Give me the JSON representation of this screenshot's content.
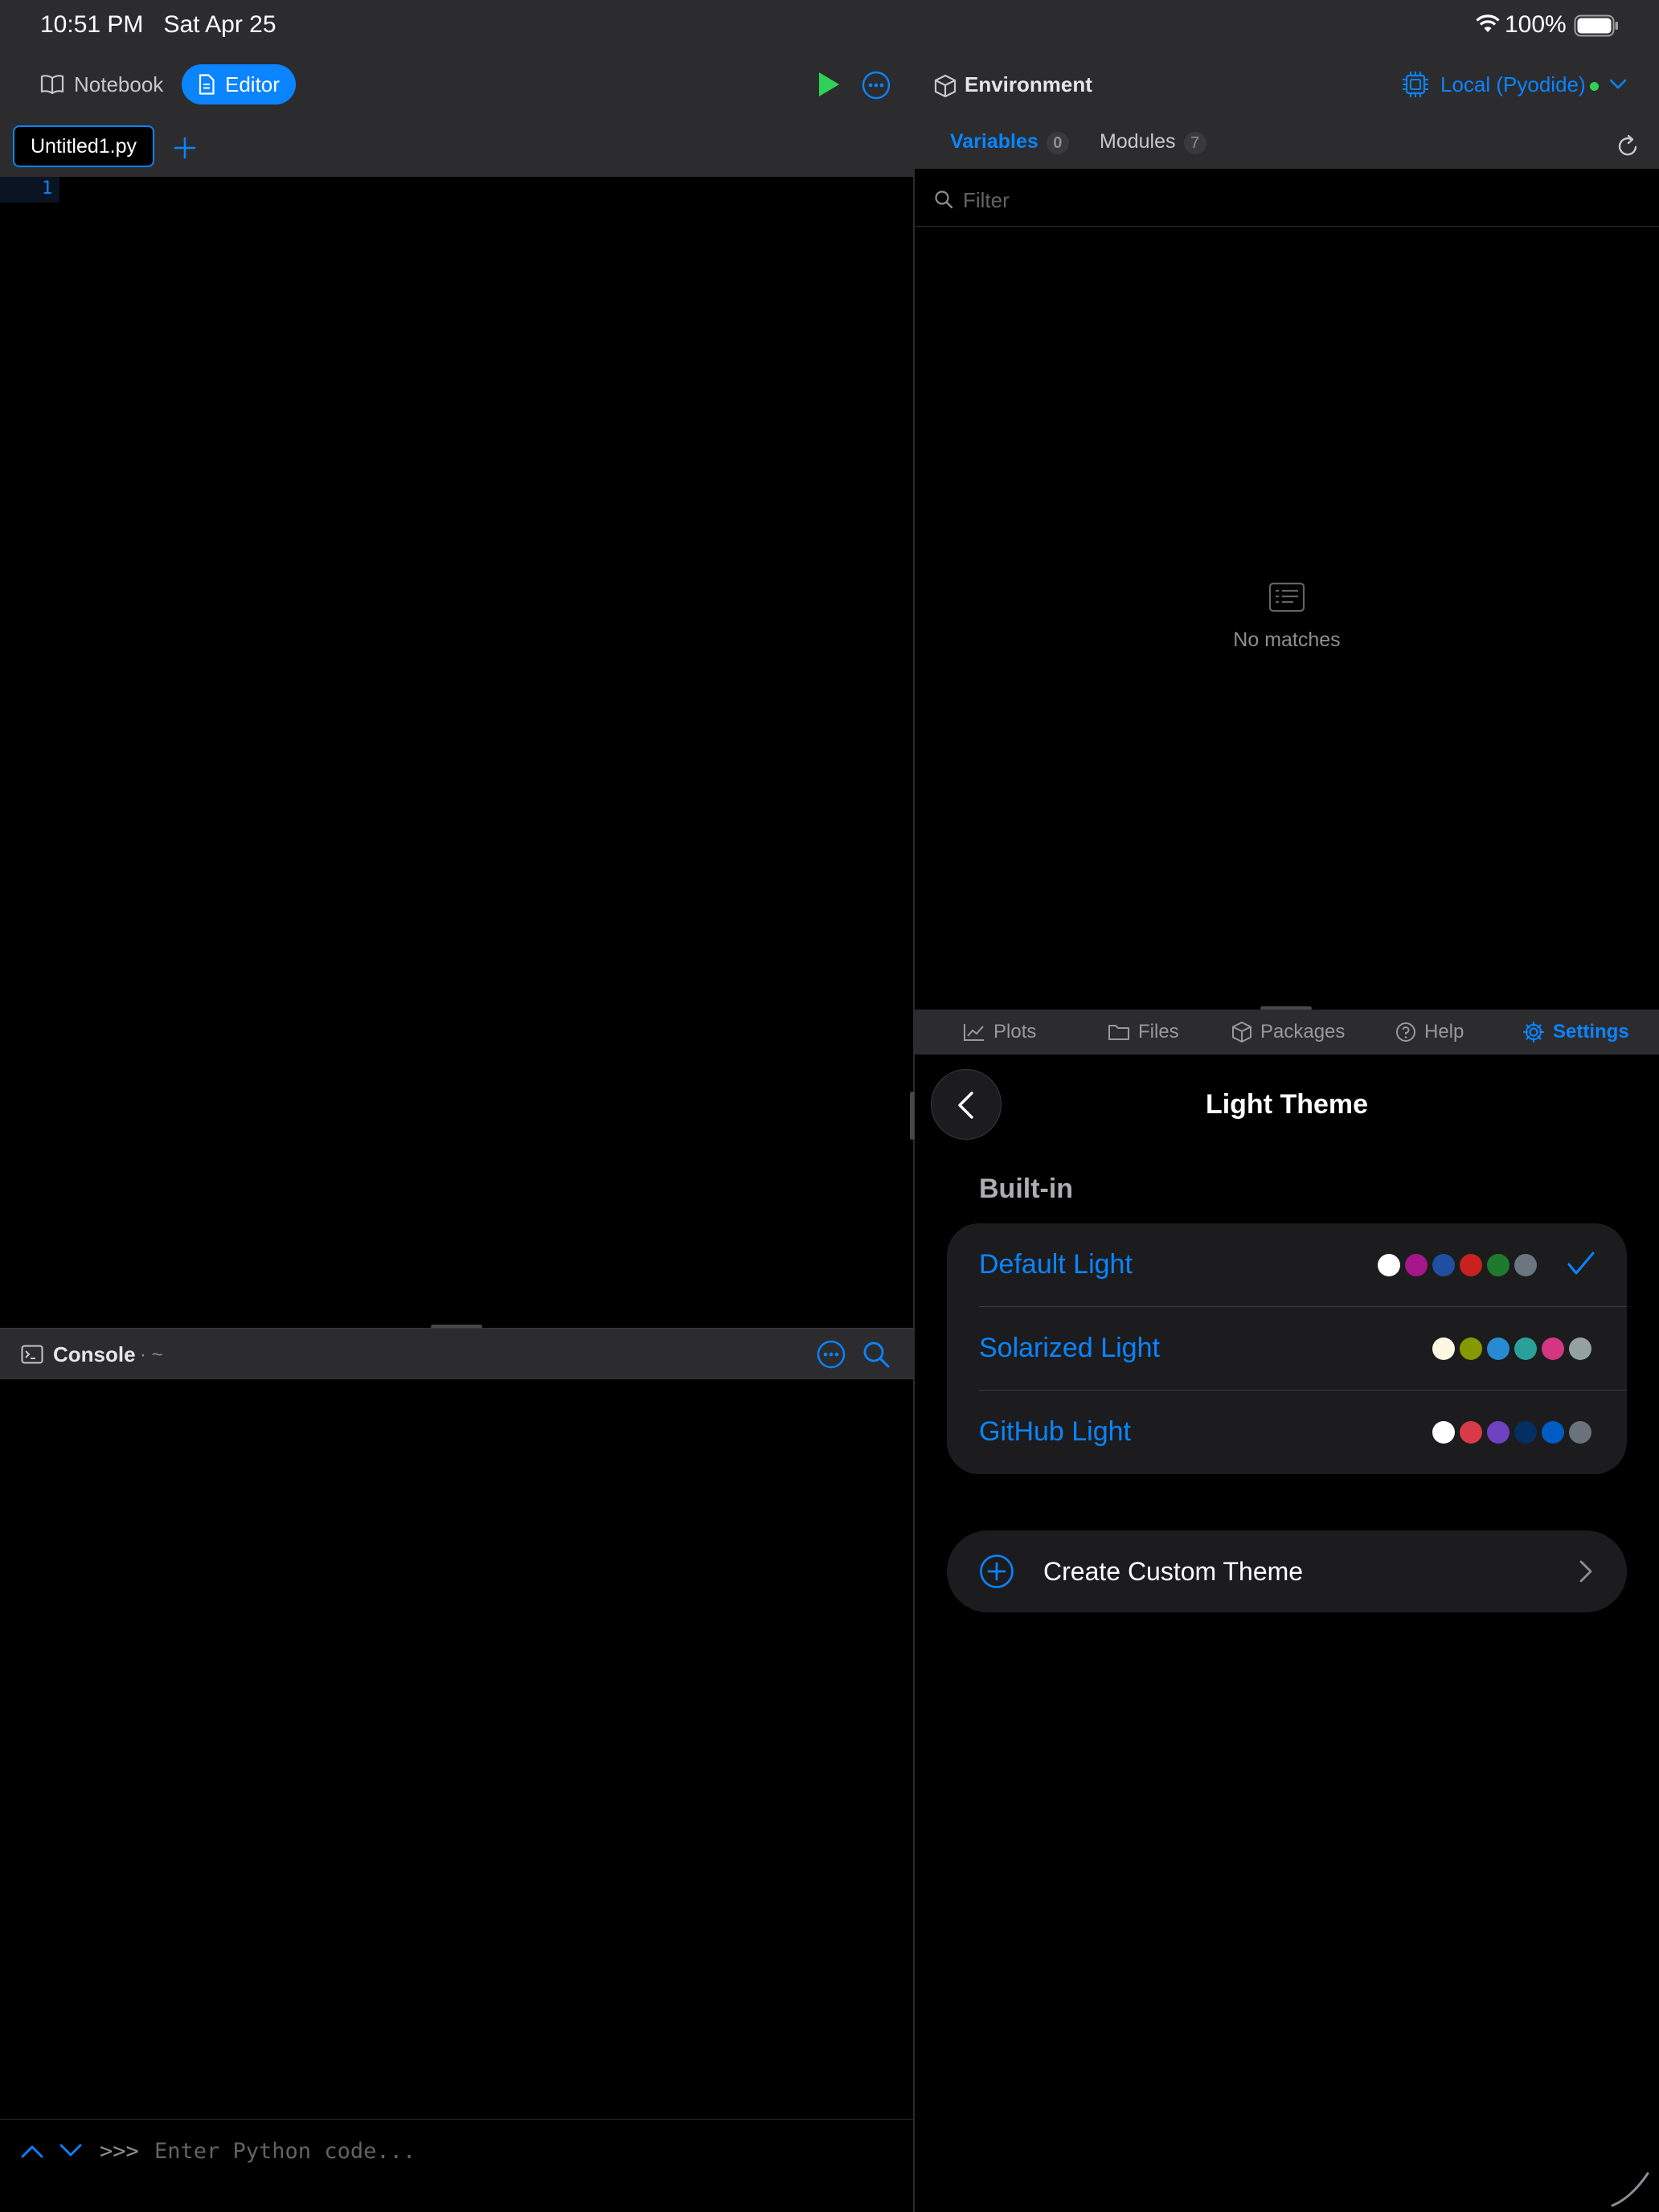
{
  "status_bar": {
    "time": "10:51 PM",
    "date": "Sat Apr 25",
    "battery": "100%"
  },
  "left": {
    "notebook_label": "Notebook",
    "editor_label": "Editor",
    "file_tab": "Untitled1.py",
    "line_number": "1",
    "console_title": "Console",
    "console_path": "· ~",
    "console_prompt": ">>>",
    "console_placeholder": "Enter Python code..."
  },
  "right": {
    "environment_label": "Environment",
    "runtime_label": "Local (Pyodide)",
    "variables_tab": "Variables",
    "variables_count": "0",
    "modules_tab": "Modules",
    "modules_count": "7",
    "filter_placeholder": "Filter",
    "empty_state": "No matches",
    "bottom_tabs": {
      "plots": "Plots",
      "files": "Files",
      "packages": "Packages",
      "help": "Help",
      "settings": "Settings"
    },
    "page_title": "Light Theme",
    "section_label": "Built-in",
    "themes": [
      {
        "name": "Default Light",
        "selected": true,
        "colors": [
          "#ffffff",
          "#a5168a",
          "#1f4fa0",
          "#c9211e",
          "#1f7a30",
          "#6b7580"
        ]
      },
      {
        "name": "Solarized Light",
        "selected": false,
        "colors": [
          "#fdf6e3",
          "#859900",
          "#268bd2",
          "#2aa198",
          "#d33682",
          "#93a1a1"
        ]
      },
      {
        "name": "GitHub Light",
        "selected": false,
        "colors": [
          "#ffffff",
          "#d73a49",
          "#6f42c1",
          "#032f62",
          "#005cc5",
          "#6a737d"
        ]
      }
    ],
    "create_custom_label": "Create Custom Theme"
  },
  "colors": {
    "accent": "#0a84ff",
    "run_green": "#30d158",
    "status_dot": "#30d158",
    "panel": "#2c2c2e",
    "card": "#1c1c1e"
  }
}
